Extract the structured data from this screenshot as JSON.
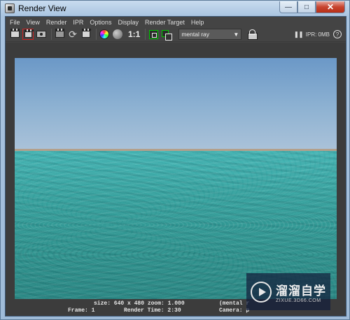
{
  "window": {
    "title": "Render View"
  },
  "menu": [
    "File",
    "View",
    "Render",
    "IPR",
    "Options",
    "Display",
    "Render Target",
    "Help"
  ],
  "toolbar": {
    "ratio_label": "1:1",
    "renderer": "mental ray",
    "ipr_memory": "IPR: 0MB",
    "help_label": "?"
  },
  "info": {
    "size_zoom": "size: 640 x 480 zoom: 1.000",
    "renderer_tag": "(mental r",
    "frame": "Frame: 1",
    "render_time": "Render Time: 2:30",
    "camera": "Camera: p"
  },
  "watermark": {
    "brand": "溜溜自学",
    "url": "ZIXUE.3D66.COM"
  }
}
